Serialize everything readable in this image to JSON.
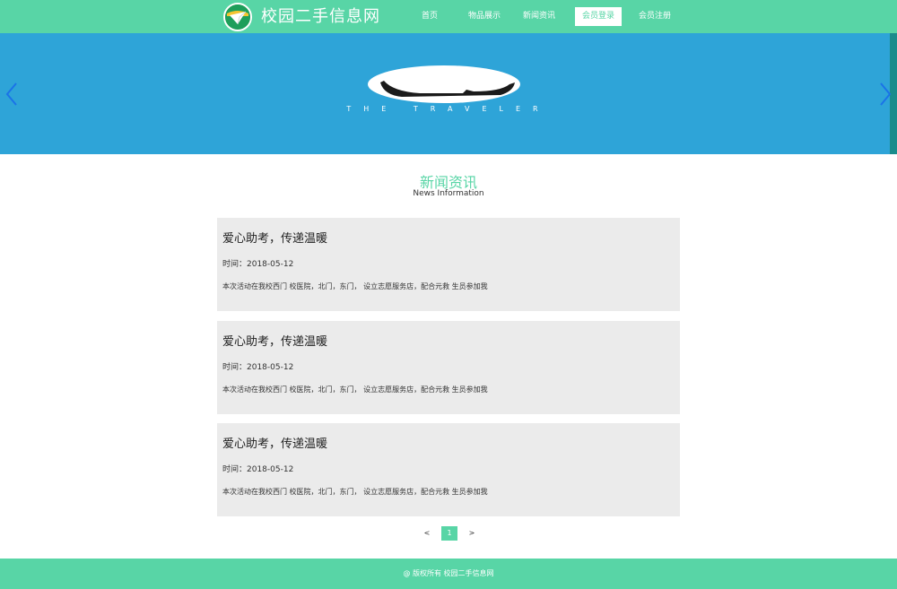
{
  "header": {
    "site_title": "校园二手信息网",
    "nav": [
      {
        "label": "首页",
        "active": false
      },
      {
        "label": "物品展示",
        "active": false
      },
      {
        "label": "新闻资讯",
        "active": false
      },
      {
        "label": "会员登录",
        "active": true
      },
      {
        "label": "会员注册",
        "active": false
      }
    ]
  },
  "banner": {
    "tagline": "THE TRAVELER",
    "prev_icon": "chevron-left-icon",
    "next_icon": "chevron-right-icon"
  },
  "section": {
    "title": "新闻资讯",
    "subtitle": "News Information"
  },
  "news": [
    {
      "title": "爱心助考，传递温暖",
      "date": "时间：2018-05-12",
      "summary": "本次活动在我校西门 校医院，北门，东门， 设立志愿服务店，配合元救 生员参加我"
    },
    {
      "title": "爱心助考，传递温暖",
      "date": "时间：2018-05-12",
      "summary": "本次活动在我校西门 校医院，北门，东门， 设立志愿服务店，配合元救 生员参加我"
    },
    {
      "title": "爱心助考，传递温暖",
      "date": "时间：2018-05-12",
      "summary": "本次活动在我校西门 校医院，北门，东门， 设立志愿服务店，配合元救 生员参加我"
    }
  ],
  "pagination": {
    "prev": "<",
    "current": "1",
    "next": ">"
  },
  "footer": {
    "copyright": "@ 版权所有 校园二手信息网"
  },
  "colors": {
    "accent": "#58d5a6",
    "banner": "#2ea4d8",
    "card": "#ebebeb"
  }
}
